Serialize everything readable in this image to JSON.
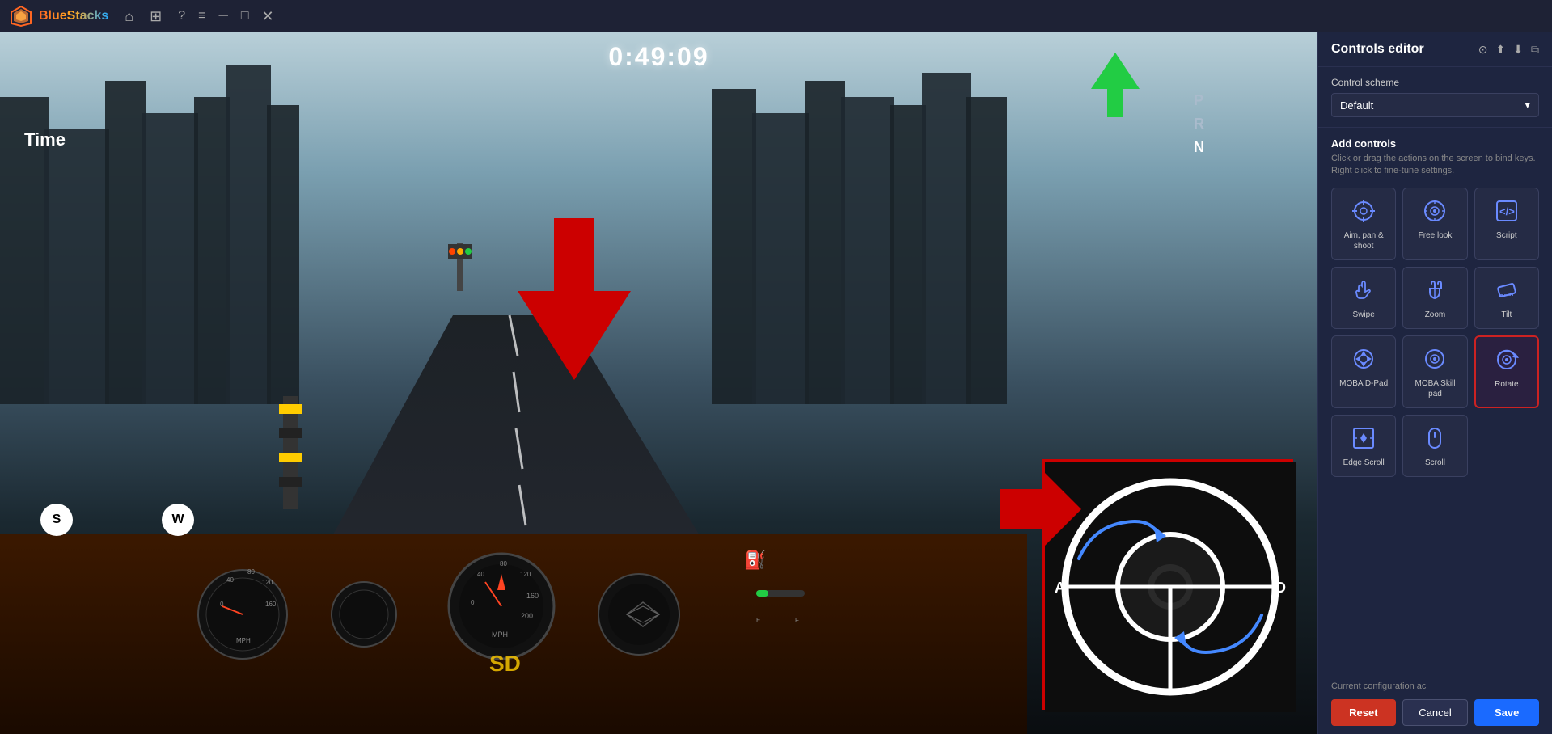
{
  "titleBar": {
    "appName": "BlueStacks",
    "navIcons": [
      "home-icon",
      "grid-icon"
    ],
    "windowIcons": [
      "help-icon",
      "menu-icon",
      "minimize-icon",
      "maximize-icon",
      "close-icon"
    ]
  },
  "gameArea": {
    "timer": "0:49:09",
    "timeLabel": "Time",
    "gearOptions": [
      "P",
      "R",
      "N"
    ],
    "activeGear": "N",
    "keyLabels": {
      "s": "S",
      "w": "W"
    },
    "sdWatermark": "SD"
  },
  "controlsPanel": {
    "title": "Controls editor",
    "headerIcons": [
      "help-circle-icon",
      "upload-icon",
      "download-icon",
      "copy-icon"
    ],
    "controlScheme": {
      "label": "Control scheme",
      "selected": "Default"
    },
    "addControls": {
      "title": "Add controls",
      "description": "Click or drag the actions on the screen to bind keys. Right click to fine-tune settings."
    },
    "controls": [
      {
        "id": "aim-pan-shoot",
        "label": "Aim, pan &\nshoot",
        "icon": "crosshair-icon"
      },
      {
        "id": "free-look",
        "label": "Free look",
        "icon": "eye-icon"
      },
      {
        "id": "script",
        "label": "Script",
        "icon": "code-icon"
      },
      {
        "id": "swipe",
        "label": "Swipe",
        "icon": "swipe-icon"
      },
      {
        "id": "zoom",
        "label": "Zoom",
        "icon": "zoom-icon"
      },
      {
        "id": "tilt",
        "label": "Tilt",
        "icon": "tilt-icon"
      },
      {
        "id": "moba-d-pad",
        "label": "MOBA D-Pad",
        "icon": "moba-dpad-icon"
      },
      {
        "id": "moba-skill-pad",
        "label": "MOBA Skill pad",
        "icon": "moba-skill-icon"
      },
      {
        "id": "rotate",
        "label": "Rotate",
        "icon": "rotate-icon",
        "selected": true
      },
      {
        "id": "edge-scroll",
        "label": "Edge Scroll",
        "icon": "edge-scroll-icon"
      },
      {
        "id": "scroll",
        "label": "Scroll",
        "icon": "scroll-icon"
      }
    ],
    "footer": {
      "configText": "Current configuration ac",
      "buttons": {
        "reset": "Reset",
        "cancel": "Cancel",
        "save": "Save"
      }
    }
  }
}
